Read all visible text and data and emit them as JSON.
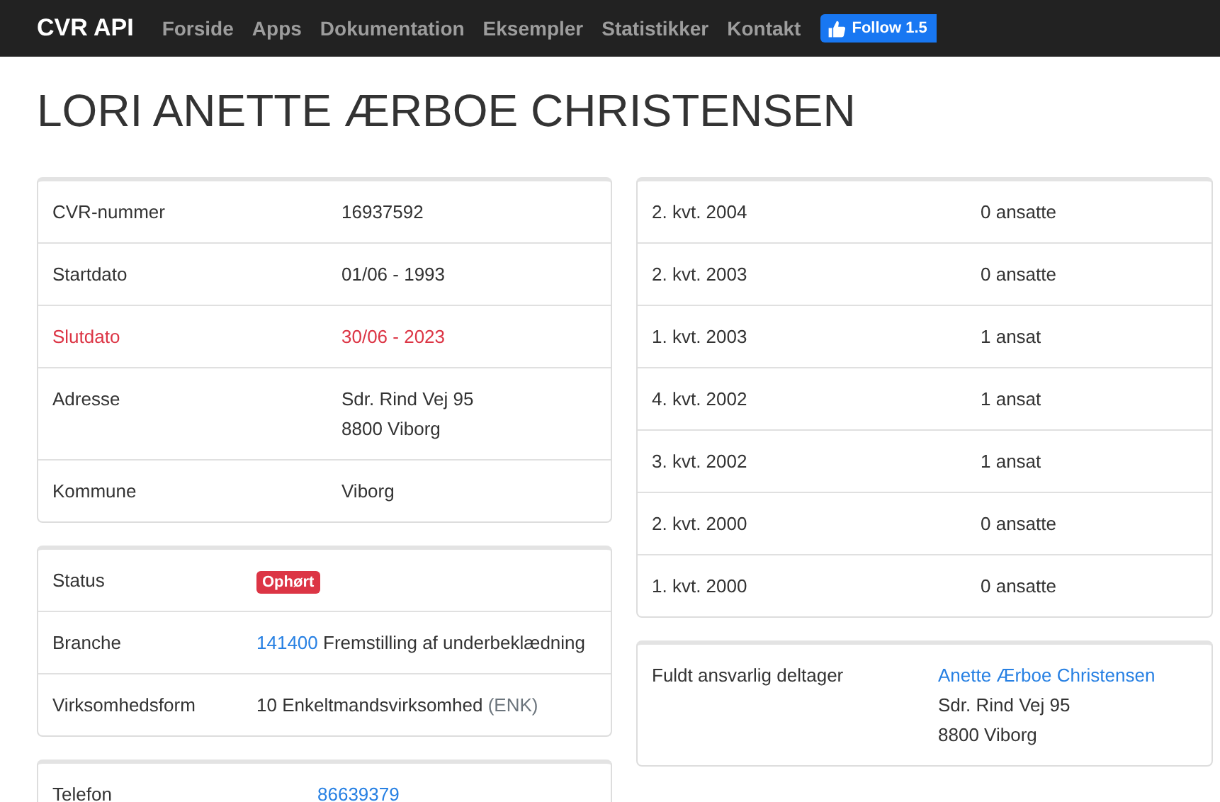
{
  "navbar": {
    "brand": "CVR API",
    "links": [
      "Forside",
      "Apps",
      "Dokumentation",
      "Eksempler",
      "Statistikker",
      "Kontakt"
    ],
    "follow_button": "Follow 1.5"
  },
  "title": "LORI ANETTE ÆRBOE CHRISTENSEN",
  "left_cards": [
    {
      "rows": [
        {
          "label": "CVR-nummer",
          "danger": false,
          "value": [
            {
              "kind": "text",
              "text": "16937592"
            }
          ]
        },
        {
          "label": "Startdato",
          "danger": false,
          "value": [
            {
              "kind": "text",
              "text": "01/06 - 1993"
            }
          ]
        },
        {
          "label": "Slutdato",
          "danger": true,
          "value": [
            {
              "kind": "text",
              "text": "30/06 - 2023"
            }
          ]
        },
        {
          "label": "Adresse",
          "danger": false,
          "value": [
            {
              "kind": "line",
              "text": "Sdr. Rind Vej 95"
            },
            {
              "kind": "line",
              "text": "8800 Viborg"
            }
          ]
        },
        {
          "label": "Kommune",
          "danger": false,
          "value": [
            {
              "kind": "text",
              "text": "Viborg"
            }
          ]
        }
      ]
    },
    {
      "rows": [
        {
          "label": "Status",
          "value": [
            {
              "kind": "badge",
              "text": "Ophørt"
            }
          ]
        },
        {
          "label": "Branche",
          "value": [
            {
              "kind": "link",
              "text": "141400"
            },
            {
              "kind": "text",
              "text": "Fremstilling af underbeklædning"
            }
          ]
        },
        {
          "label": "Virksomhedsform",
          "value": [
            {
              "kind": "text",
              "text": "10 Enkeltmandsvirksomhed"
            },
            {
              "kind": "muted",
              "text": "(ENK)"
            }
          ]
        }
      ]
    },
    {
      "rows": [
        {
          "label": "Telefon",
          "value": [
            {
              "kind": "link",
              "text": "86639379"
            }
          ]
        }
      ]
    }
  ],
  "right_cards": [
    {
      "rows": [
        {
          "label": "2. kvt. 2004",
          "value": [
            {
              "kind": "text",
              "text": "0 ansatte"
            }
          ]
        },
        {
          "label": "2. kvt. 2003",
          "value": [
            {
              "kind": "text",
              "text": "0 ansatte"
            }
          ]
        },
        {
          "label": "1. kvt. 2003",
          "value": [
            {
              "kind": "text",
              "text": "1 ansat"
            }
          ]
        },
        {
          "label": "4. kvt. 2002",
          "value": [
            {
              "kind": "text",
              "text": "1 ansat"
            }
          ]
        },
        {
          "label": "3. kvt. 2002",
          "value": [
            {
              "kind": "text",
              "text": "1 ansat"
            }
          ]
        },
        {
          "label": "2. kvt. 2000",
          "value": [
            {
              "kind": "text",
              "text": "0 ansatte"
            }
          ]
        },
        {
          "label": "1. kvt. 2000",
          "value": [
            {
              "kind": "text",
              "text": "0 ansatte"
            }
          ]
        }
      ]
    },
    {
      "rows": [
        {
          "label": "Fuldt ansvarlig deltager",
          "value": [
            {
              "kind": "link_line",
              "text": "Anette Ærboe Christensen"
            },
            {
              "kind": "line",
              "text": "Sdr. Rind Vej 95"
            },
            {
              "kind": "line",
              "text": "8800 Viborg"
            }
          ]
        }
      ]
    }
  ]
}
